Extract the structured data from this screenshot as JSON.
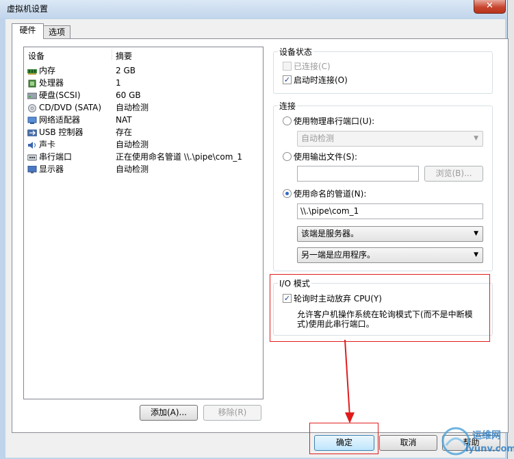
{
  "window": {
    "title": "虚拟机设置",
    "close_glyph": "✕"
  },
  "tabs": [
    {
      "label": "硬件"
    },
    {
      "label": "选项"
    }
  ],
  "device_table": {
    "col_device": "设备",
    "col_summary": "摘要",
    "rows": [
      {
        "device": "内存",
        "summary": "2 GB",
        "icon": "memory-icon"
      },
      {
        "device": "处理器",
        "summary": "1",
        "icon": "processor-icon"
      },
      {
        "device": "硬盘(SCSI)",
        "summary": "60 GB",
        "icon": "hard-disk-icon"
      },
      {
        "device": "CD/DVD (SATA)",
        "summary": "自动检测",
        "icon": "cd-dvd-icon"
      },
      {
        "device": "网络适配器",
        "summary": "NAT",
        "icon": "network-adapter-icon"
      },
      {
        "device": "USB 控制器",
        "summary": "存在",
        "icon": "usb-icon"
      },
      {
        "device": "声卡",
        "summary": "自动检测",
        "icon": "sound-card-icon"
      },
      {
        "device": "串行端口",
        "summary": "正在使用命名管道 \\\\.\\pipe\\com_1",
        "icon": "serial-port-icon"
      },
      {
        "device": "显示器",
        "summary": "自动检测",
        "icon": "display-icon"
      }
    ]
  },
  "list_buttons": {
    "add": "添加(A)...",
    "remove": "移除(R)"
  },
  "device_status": {
    "title": "设备状态",
    "connected": {
      "label": "已连接(C)",
      "checked": false,
      "enabled": false
    },
    "connect_at_power_on": {
      "label": "启动时连接(O)",
      "checked": true
    }
  },
  "connection": {
    "title": "连接",
    "use_physical": {
      "label": "使用物理串行端口(U):",
      "selected": false
    },
    "physical_combo": "自动检测",
    "use_output_file": {
      "label": "使用输出文件(S):",
      "selected": false
    },
    "output_file_value": "",
    "browse_button": "浏览(B)...",
    "use_named_pipe": {
      "label": "使用命名的管道(N):",
      "selected": true
    },
    "pipe_name": "\\\\.\\pipe\\com_1",
    "end_combo": "该端是服务器。",
    "other_end_combo": "另一端是应用程序。"
  },
  "io_mode": {
    "title": "I/O 模式",
    "yield_cpu": {
      "label": "轮询时主动放弃 CPU(Y)",
      "checked": true
    },
    "description_line1": "允许客户机操作系统在轮询模式下(而不是中断模",
    "description_line2": "式)使用此串行端口。"
  },
  "dialog_buttons": {
    "ok": "确定",
    "cancel": "取消",
    "help": "帮助"
  },
  "watermark": {
    "brand": "运维网",
    "url": "iyunv.com"
  },
  "colors": {
    "highlight_red": "#e01b1b",
    "accent_blue": "#2e6bc7"
  }
}
